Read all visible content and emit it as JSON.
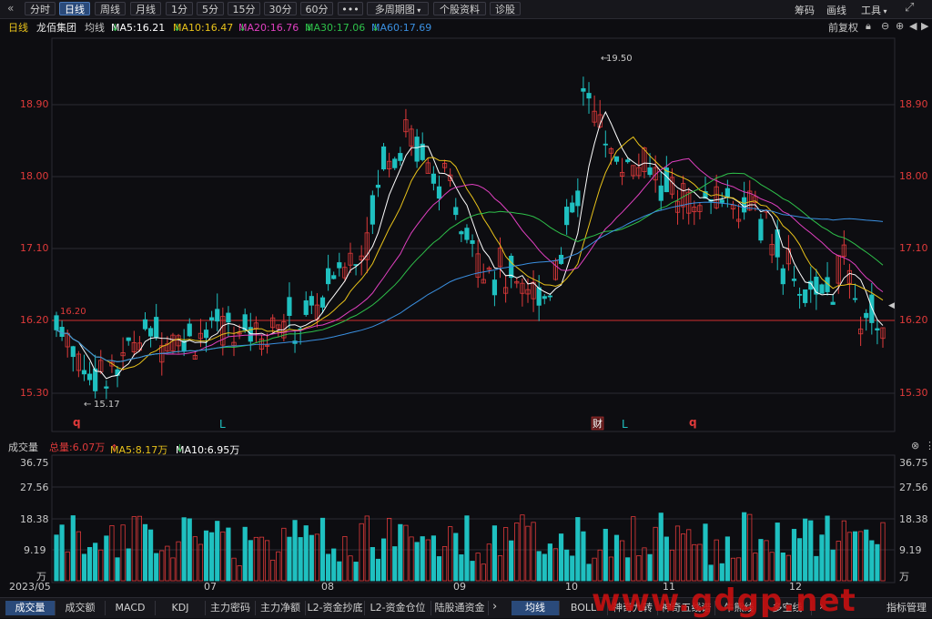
{
  "toolbar": {
    "back_icon": "double-left-chevron-icon",
    "periods": [
      "分时",
      "日线",
      "周线",
      "月线",
      "1分",
      "5分",
      "15分",
      "30分",
      "60分"
    ],
    "active_period": "日线",
    "more_label": "•••",
    "multi_period": "多周期图",
    "stock_info": "个股资料",
    "diagnose": "诊股",
    "right_items": [
      "筹码",
      "画线",
      "工具"
    ]
  },
  "header": {
    "period": "日线",
    "stock_name": "龙佰集团",
    "ma_label": "均线",
    "ma5": "MA5:16.21",
    "ma10": "MA10:16.47",
    "ma20": "MA20:16.76",
    "ma30": "MA30:17.06",
    "ma60": "MA60:17.69",
    "adjust": "前复权"
  },
  "price_axis": {
    "left_ticks": [
      "18.90",
      "18.00",
      "17.10",
      "16.20",
      "15.30"
    ],
    "right_ticks": [
      "18.90",
      "18.00",
      "17.10",
      "16.20",
      "15.30"
    ]
  },
  "annotations": {
    "high_label": "19.50",
    "low_label": "15.17",
    "ref_label": "16.20",
    "markers": [
      "q",
      "L",
      "财",
      "L",
      "q"
    ]
  },
  "volume_header": {
    "title": "成交量",
    "total": "总量:6.07万",
    "ma5": "MA5:8.17万",
    "ma10": "MA10:6.95万"
  },
  "volume_axis": {
    "ticks": [
      "36.75",
      "27.56",
      "18.38",
      "9.19",
      "万"
    ]
  },
  "x_axis": {
    "labels": [
      "2023/05",
      "07",
      "08",
      "09",
      "10",
      "11",
      "12"
    ]
  },
  "bottom_tabs_left": [
    "成交量",
    "成交额",
    "MACD",
    "KDJ",
    "主力密码",
    "主力净额",
    "L2-资金抄底",
    "L2-资金仓位",
    "陆股通资金"
  ],
  "bottom_tabs_right": [
    "均线",
    "BOLL",
    "神奇九转",
    "神奇五线谱",
    "牛熊线",
    "多空线",
    "指标管理"
  ],
  "watermark": "www.gdgp.net",
  "colors": {
    "up": "#e03a3a",
    "down": "#1fc0c0",
    "ma5": "#ffffff",
    "ma10": "#e8c21a",
    "ma20": "#e040c0",
    "ma30": "#2ec04a",
    "ma60": "#3a8fe0"
  }
}
